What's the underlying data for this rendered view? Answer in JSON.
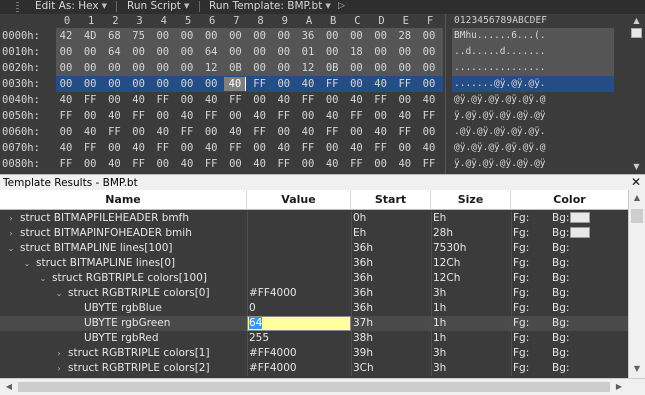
{
  "toolbar": {
    "edit_as": "Edit As: Hex",
    "run_script": "Run Script",
    "run_template": "Run Template: BMP.bt"
  },
  "hex": {
    "col_headers": [
      "0",
      "1",
      "2",
      "3",
      "4",
      "5",
      "6",
      "7",
      "8",
      "9",
      "A",
      "B",
      "C",
      "D",
      "E",
      "F"
    ],
    "ascii_header": "0123456789ABCDEF",
    "rows": [
      {
        "addr": "0000h:",
        "bytes": [
          "42",
          "4D",
          "68",
          "75",
          "00",
          "00",
          "00",
          "00",
          "00",
          "00",
          "36",
          "00",
          "00",
          "00",
          "28",
          "00"
        ],
        "ascii": "BMhu......6...(."
      },
      {
        "addr": "0010h:",
        "bytes": [
          "00",
          "00",
          "64",
          "00",
          "00",
          "00",
          "64",
          "00",
          "00",
          "00",
          "01",
          "00",
          "18",
          "00",
          "00",
          "00"
        ],
        "ascii": "..d.....d......."
      },
      {
        "addr": "0020h:",
        "bytes": [
          "00",
          "00",
          "00",
          "00",
          "00",
          "00",
          "12",
          "0B",
          "00",
          "00",
          "12",
          "0B",
          "00",
          "00",
          "00",
          "00"
        ],
        "ascii": "................"
      },
      {
        "addr": "0030h:",
        "bytes": [
          "00",
          "00",
          "00",
          "00",
          "00",
          "00",
          "00",
          "40",
          "FF",
          "00",
          "40",
          "FF",
          "00",
          "40",
          "FF",
          "00"
        ],
        "ascii": ".......@ÿ.@ÿ.@ÿ."
      },
      {
        "addr": "0040h:",
        "bytes": [
          "40",
          "FF",
          "00",
          "40",
          "FF",
          "00",
          "40",
          "FF",
          "00",
          "40",
          "FF",
          "00",
          "40",
          "FF",
          "00",
          "40"
        ],
        "ascii": "@ÿ.@ÿ.@ÿ.@ÿ.@ÿ.@"
      },
      {
        "addr": "0050h:",
        "bytes": [
          "FF",
          "00",
          "40",
          "FF",
          "00",
          "40",
          "FF",
          "00",
          "40",
          "FF",
          "00",
          "40",
          "FF",
          "00",
          "40",
          "FF"
        ],
        "ascii": "ÿ.@ÿ.@ÿ.@ÿ.@ÿ.@ÿ"
      },
      {
        "addr": "0060h:",
        "bytes": [
          "00",
          "40",
          "FF",
          "00",
          "40",
          "FF",
          "00",
          "40",
          "FF",
          "00",
          "40",
          "FF",
          "00",
          "40",
          "FF",
          "00"
        ],
        "ascii": ".@ÿ.@ÿ.@ÿ.@ÿ.@ÿ."
      },
      {
        "addr": "0070h:",
        "bytes": [
          "40",
          "FF",
          "00",
          "40",
          "FF",
          "00",
          "40",
          "FF",
          "00",
          "40",
          "FF",
          "00",
          "40",
          "FF",
          "00",
          "40"
        ],
        "ascii": "@ÿ.@ÿ.@ÿ.@ÿ.@ÿ.@"
      },
      {
        "addr": "0080h:",
        "bytes": [
          "FF",
          "00",
          "40",
          "FF",
          "00",
          "40",
          "FF",
          "00",
          "40",
          "FF",
          "00",
          "40",
          "FF",
          "00",
          "40",
          "FF"
        ],
        "ascii": "ÿ.@ÿ.@ÿ.@ÿ.@ÿ.@ÿ"
      }
    ],
    "highlight_colors": {
      "header_region": "#555555",
      "selection": "#244d86"
    }
  },
  "results": {
    "title": "Template Results - BMP.bt",
    "columns": {
      "name": "Name",
      "value": "Value",
      "start": "Start",
      "size": "Size",
      "color": "Color"
    },
    "rows": [
      {
        "name": "struct BITMAPFILEHEADER bmfh",
        "value": "",
        "start": "0h",
        "size": "Eh",
        "fg": "Fg:",
        "bg": "Bg:",
        "expander": "›",
        "swatch": true
      },
      {
        "name": "struct BITMAPINFOHEADER bmih",
        "value": "",
        "start": "Eh",
        "size": "28h",
        "fg": "Fg:",
        "bg": "Bg:",
        "expander": "›",
        "swatch": true
      },
      {
        "name": "struct BITMAPLINE lines[100]",
        "value": "",
        "start": "36h",
        "size": "7530h",
        "fg": "Fg:",
        "bg": "Bg:",
        "expander": "⌄",
        "swatch": false
      },
      {
        "name": "struct BITMAPLINE lines[0]",
        "value": "",
        "start": "36h",
        "size": "12Ch",
        "fg": "Fg:",
        "bg": "Bg:",
        "expander": "⌄",
        "swatch": false
      },
      {
        "name": "struct RGBTRIPLE colors[100]",
        "value": "",
        "start": "36h",
        "size": "12Ch",
        "fg": "Fg:",
        "bg": "Bg:",
        "expander": "⌄",
        "swatch": false
      },
      {
        "name": "struct RGBTRIPLE colors[0]",
        "value": "#FF4000",
        "start": "36h",
        "size": "3h",
        "fg": "Fg:",
        "bg": "Bg:",
        "expander": "⌄",
        "swatch": false
      },
      {
        "name": "UBYTE rgbBlue",
        "value": "0",
        "start": "36h",
        "size": "1h",
        "fg": "Fg:",
        "bg": "Bg:",
        "expander": "",
        "swatch": false
      },
      {
        "name": "UBYTE rgbGreen",
        "value": "64",
        "start": "37h",
        "size": "1h",
        "fg": "Fg:",
        "bg": "Bg:",
        "expander": "",
        "swatch": false
      },
      {
        "name": "UBYTE rgbRed",
        "value": "255",
        "start": "38h",
        "size": "1h",
        "fg": "Fg:",
        "bg": "Bg:",
        "expander": "",
        "swatch": false
      },
      {
        "name": "struct RGBTRIPLE colors[1]",
        "value": "#FF4000",
        "start": "39h",
        "size": "3h",
        "fg": "Fg:",
        "bg": "Bg:",
        "expander": "›",
        "swatch": false
      },
      {
        "name": "struct RGBTRIPLE colors[2]",
        "value": "#FF4000",
        "start": "3Ch",
        "size": "3h",
        "fg": "Fg:",
        "bg": "Bg:",
        "expander": "›",
        "swatch": false
      }
    ],
    "editing": {
      "value": "64"
    }
  }
}
